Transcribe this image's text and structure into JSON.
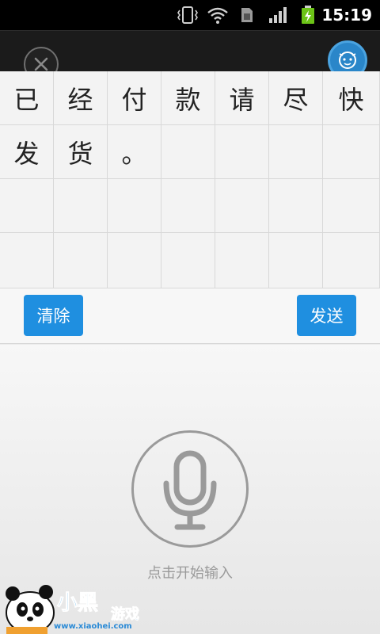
{
  "status_bar": {
    "time": "15:19",
    "icons": [
      "vibrate-icon",
      "wifi-icon",
      "sim-icon",
      "signal-icon",
      "battery-charging-icon"
    ]
  },
  "header": {
    "close_icon": "close-icon",
    "assistant_icon": "robot-face-icon",
    "accent": "#2a86c9"
  },
  "grid": {
    "rows": [
      [
        "已",
        "经",
        "付",
        "款",
        "请",
        "尽",
        "快"
      ],
      [
        "发",
        "货",
        "。",
        "",
        "",
        "",
        ""
      ],
      [
        "",
        "",
        "",
        "",
        "",
        "",
        ""
      ],
      [
        "",
        "",
        "",
        "",
        "",
        "",
        ""
      ]
    ]
  },
  "actions": {
    "clear_label": "清除",
    "send_label": "发送",
    "button_color": "#1f8fe0"
  },
  "voice": {
    "mic_icon": "microphone-icon",
    "hint": "点击开始输入"
  },
  "watermark": {
    "logo_text": "小黑游戏",
    "url": "www.xiaohei.com"
  }
}
